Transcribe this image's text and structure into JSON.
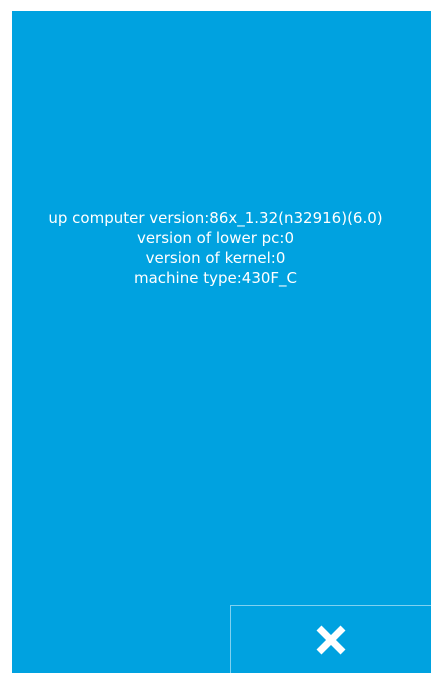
{
  "info": {
    "line1": "up computer version:86x_1.32(n32916)(6.0)",
    "line2": "version of lower pc:0",
    "line3": "version of kernel:0",
    "line4": "machine type:430F_C"
  },
  "close_button": {
    "icon": "close-icon"
  },
  "colors": {
    "background": "#00a2e0",
    "text": "#ffffff",
    "border": "#7fd1f0"
  }
}
